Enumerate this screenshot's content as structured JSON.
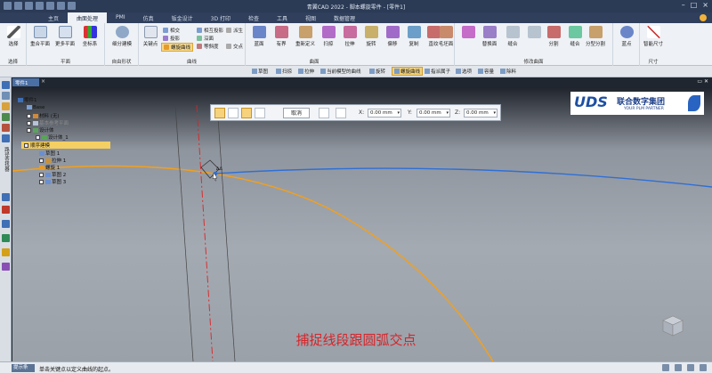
{
  "window": {
    "title": "青翼CAD 2022 - 脚本螺旋零件 - [零件1]"
  },
  "ribbon_tabs": [
    "主页",
    "曲面处理",
    "PMI",
    "仿真",
    "钣金设计",
    "3D 打印",
    "检查",
    "工具",
    "视图",
    "数据管理"
  ],
  "ribbon": {
    "groups": {
      "select": "选择",
      "plane": "平面",
      "free_form": "自由形状",
      "curve": "曲线",
      "surface": "曲面",
      "assembly": "修改曲面",
      "size": "尺寸"
    },
    "buttons": {
      "select": "选择",
      "coincident_plane": "重合平面",
      "more_planes": "更多平面",
      "coord_system": "坐标系",
      "blue_surf": "蓝面",
      "bounded": "有界",
      "redefine": "重新定义",
      "sweep": "扫掠",
      "extrude": "拉伸",
      "revolve": "旋转",
      "offset": "偏移",
      "copy": "复制",
      "ruled": "直纹",
      "trim_curve": "毛坯面",
      "replace_face": "替换面",
      "stitch": "缝合",
      "split": "分割",
      "combine": "缝合",
      "split_model": "分型分割",
      "blue_point": "蓝点",
      "smart_dim": "智能尺寸",
      "thin_wrap": "细分建模",
      "key_point": "关键点"
    },
    "curve_small": {
      "intersect": "相交",
      "project": "投影",
      "helix": "螺旋曲线",
      "intersect2": "相互投影",
      "along": "沿面",
      "iso": "等斜度",
      "derive": "派生",
      "cross": "交点"
    }
  },
  "selection_bar": [
    "草图",
    "扫掠",
    "拉伸",
    "当前模型的曲线",
    "旋转",
    "螺旋曲线",
    "指派属子",
    "选项",
    "容量",
    "除料"
  ],
  "document": {
    "tab": "零件1",
    "close_glyph": "×"
  },
  "tree": {
    "root": "零件1",
    "base": "Base",
    "material": "材料 (无)",
    "ref_plane": "基本参考平面",
    "design_body": "设计体",
    "design_body_1": "设计体_1",
    "ordered": "顺序建模",
    "sketch1": "草图 1",
    "extrude1": "拉伸 1",
    "helix1": "螺旋 1",
    "sketch2": "草图 2",
    "sketch3": "草图 3"
  },
  "input_bar": {
    "cancel": "取消",
    "x_label": "X:",
    "y_label": "Y:",
    "z_label": "Z:",
    "x_value": "0.00 mm",
    "y_value": "0.00 mm",
    "z_value": "0.00 mm"
  },
  "logo": {
    "mark": "UDS",
    "name": "联合数字集团",
    "tagline": "YOUR PLM PARTNER"
  },
  "caption": "捕捉线段跟圆弧交点",
  "status": {
    "label": "提示条",
    "tip": "单击关键点以定义曲线的起点。"
  },
  "colors": {
    "arc_orange": "#f0a020",
    "line_blue": "#2f6fd6",
    "construction_red": "#d22",
    "highlight": "#f4cf63",
    "caption_red": "#d6252a"
  },
  "icons": [
    "select-arrow-icon",
    "plane-icon",
    "coordinate-icon",
    "helix-icon",
    "cancel-icon",
    "snap-icon",
    "view-cube-icon"
  ]
}
